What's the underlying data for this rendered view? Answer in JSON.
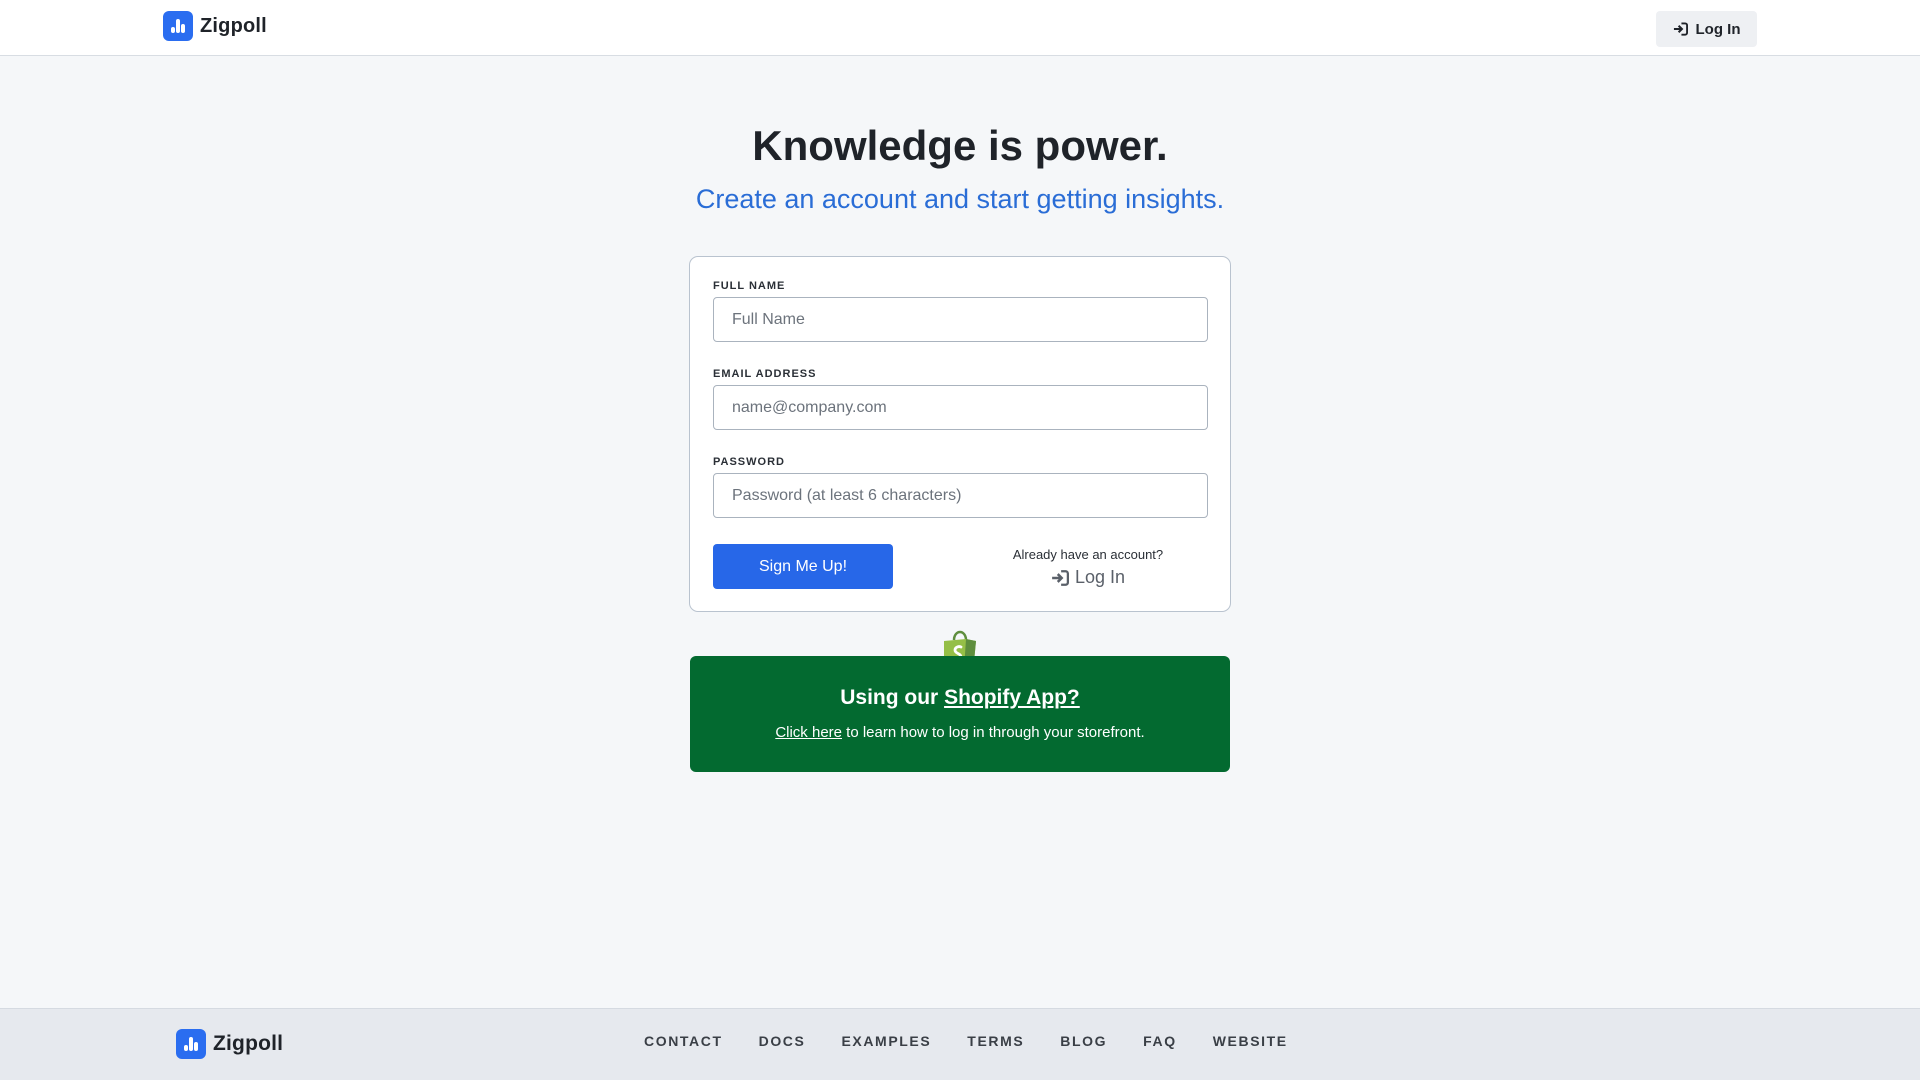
{
  "header": {
    "brand": "Zigpoll",
    "login_label": "Log In"
  },
  "hero": {
    "title": "Knowledge is power.",
    "subtitle": "Create an account and start getting insights."
  },
  "form": {
    "full_name": {
      "label": "FULL NAME",
      "placeholder": "Full Name",
      "value": ""
    },
    "email": {
      "label": "EMAIL ADDRESS",
      "placeholder": "name@company.com",
      "value": ""
    },
    "password": {
      "label": "PASSWORD",
      "placeholder": "Password (at least 6 characters)",
      "value": ""
    },
    "submit_label": "Sign Me Up!",
    "already_text": "Already have an account?",
    "login_label": "Log In"
  },
  "shopify": {
    "title_prefix": "Using our ",
    "title_link": "Shopify App?",
    "line_link": "Click here",
    "line_suffix": " to learn how to log in through your storefront."
  },
  "footer": {
    "brand": "Zigpoll",
    "nav": [
      "CONTACT",
      "DOCS",
      "EXAMPLES",
      "TERMS",
      "BLOG",
      "FAQ",
      "WEBSITE"
    ]
  },
  "colors": {
    "brand_blue": "#2a6df0",
    "button_blue": "#2767e8",
    "subtitle_blue": "#2a6dd6",
    "shopify_green": "#036a30"
  }
}
